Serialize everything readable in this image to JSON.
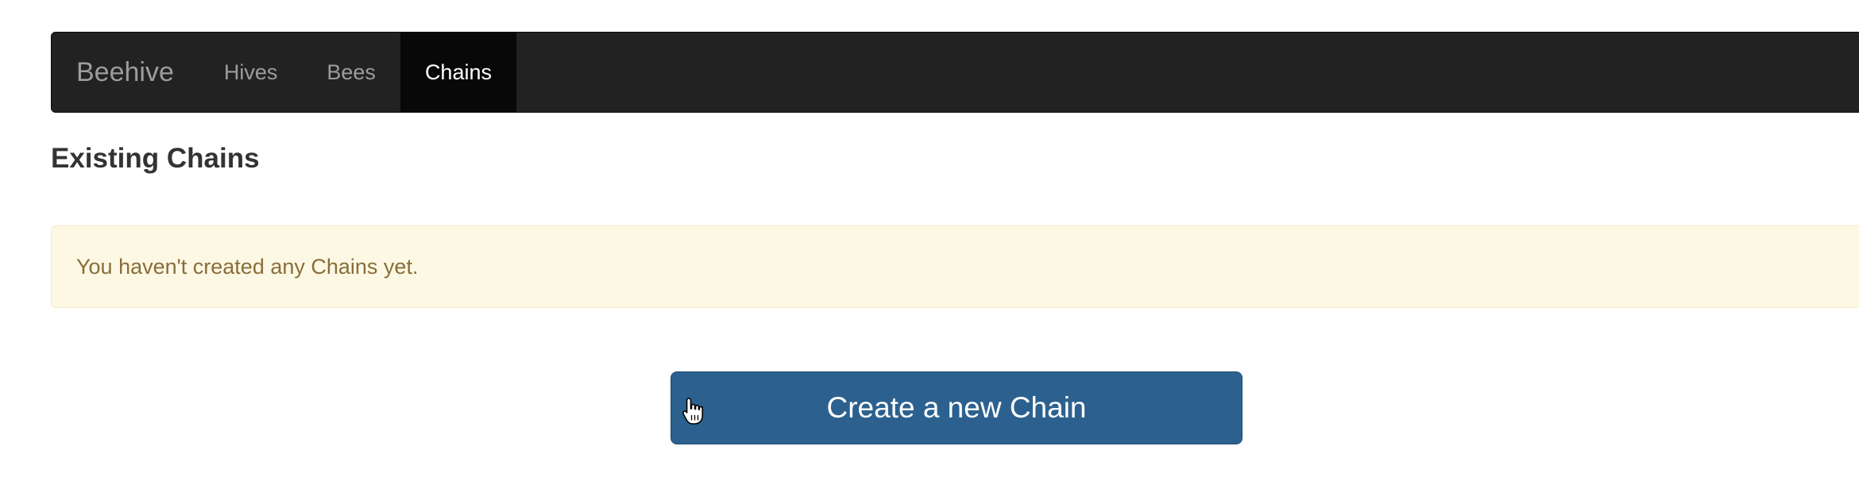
{
  "navbar": {
    "brand": "Beehive",
    "items": [
      {
        "label": "Hives",
        "active": false
      },
      {
        "label": "Bees",
        "active": false
      },
      {
        "label": "Chains",
        "active": true
      }
    ]
  },
  "main": {
    "title": "Existing Chains",
    "alert_text": "You haven't created any Chains yet.",
    "create_button_label": "Create a new Chain"
  },
  "colors": {
    "navbar_bg": "#222222",
    "nav_active_bg": "#080808",
    "alert_bg": "#fcf8e3",
    "alert_text": "#8a6d3b",
    "button_bg": "#2c618f"
  },
  "icons": {
    "cursor": "pointer-hand-icon"
  }
}
